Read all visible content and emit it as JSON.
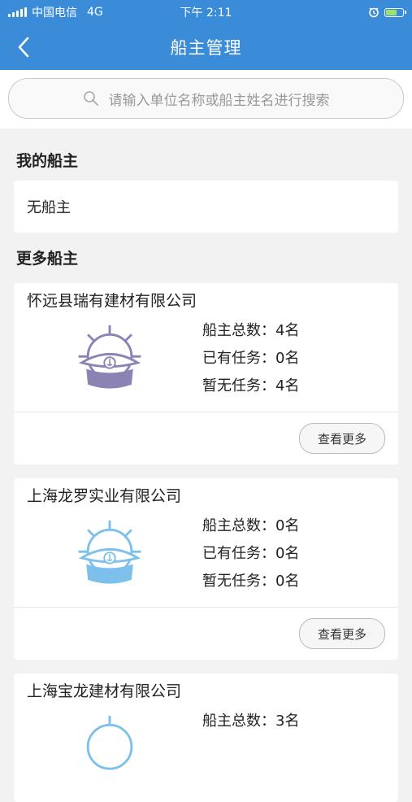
{
  "status": {
    "carrier": "中国电信",
    "network": "4G",
    "time": "下午 2:11"
  },
  "nav": {
    "title": "船主管理"
  },
  "search": {
    "placeholder": "请输入单位名称或船主姓名进行搜索"
  },
  "my_section": {
    "title": "我的船主",
    "empty_text": "无船主"
  },
  "more_section": {
    "title": "更多船主"
  },
  "companies": [
    {
      "name": "怀远县瑞有建材有限公司",
      "total": "船主总数：4名",
      "busy": "已有任务：0名",
      "idle": "暂无任务：4名",
      "button": "查看更多",
      "logo_color": "#8c83b5"
    },
    {
      "name": "上海龙罗实业有限公司",
      "total": "船主总数：0名",
      "busy": "已有任务：0名",
      "idle": "暂无任务：0名",
      "button": "查看更多",
      "logo_color": "#7ec0ec"
    },
    {
      "name": "上海宝龙建材有限公司",
      "total": "船主总数：3名",
      "busy": "",
      "idle": "",
      "button": "",
      "logo_color": "#7ec0ec"
    }
  ]
}
